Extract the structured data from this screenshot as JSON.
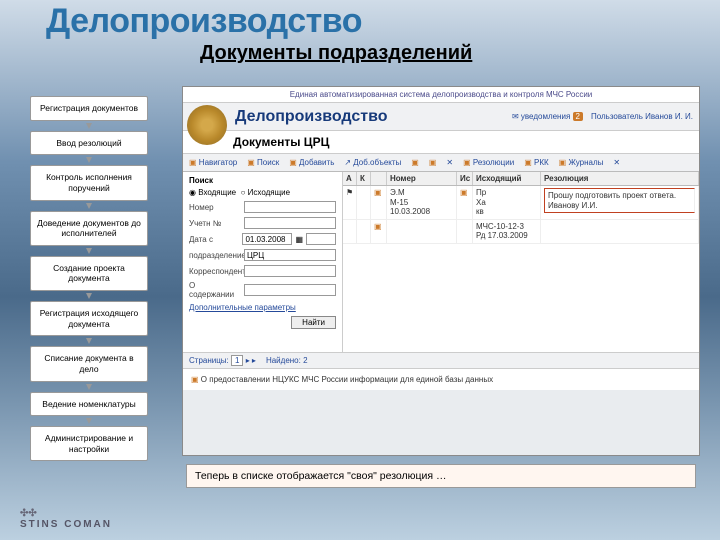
{
  "page": {
    "title": "Делопроизводство",
    "subtitle": "Документы подразделений"
  },
  "sidebar": {
    "items": [
      {
        "label": "Регистрация документов"
      },
      {
        "label": "Ввод резолюций"
      },
      {
        "label": "Контроль исполнения поручений"
      },
      {
        "label": "Доведение документов до исполнителей"
      },
      {
        "label": "Создание проекта документа"
      },
      {
        "label": "Регистрация исходящего документа"
      },
      {
        "label": "Списание документа в дело"
      },
      {
        "label": "Ведение номенклатуры"
      },
      {
        "label": "Администрирование и настройки"
      }
    ]
  },
  "app": {
    "top_banner": "Единая автоматизированная система делопроизводства и контроля МЧС России",
    "title": "Делопроизводство",
    "notify_label": "уведомления",
    "notify_count": "2",
    "user_label": "Пользователь",
    "user_name": "Иванов И. И.",
    "doc_section": "Документы ЦРЦ",
    "tabs": {
      "navigator": "Навигатор",
      "search": "Поиск",
      "add": "Добавить",
      "addmulti": "Доб.объекты",
      "resolutions": "Резолюции",
      "rkk": "РКК",
      "journals": "Журналы"
    },
    "search": {
      "title": "Поиск",
      "mode_in": "Входящие",
      "mode_out": "Исходящие",
      "fields": {
        "number": "Номер",
        "uch": "Учетн №",
        "date": "Дата с",
        "date_val": "01.03.2008",
        "dept": "подразделение",
        "dept_val": "ЦРЦ",
        "corr": "Корреспондент",
        "subject": "О содержании",
        "extra": "Дополнительные параметры"
      },
      "button": "Найти"
    },
    "list": {
      "cols": {
        "a": "А",
        "k": "К",
        "n": "",
        "num": "Номер",
        "i": "Ис",
        "out": "Исходящий",
        "res": "Резолюция"
      },
      "rows": [
        {
          "num_line1": "Э.М",
          "num_line2": "М-15",
          "num_line3": "10.03.2008",
          "out_line1": "Пр",
          "out_line2": "Ха",
          "out_line3": "кв",
          "res": "Прошу подготовить проект ответа. Иванову И.И."
        },
        {
          "num_line1": "",
          "num_line2": "",
          "num_line3": "",
          "out_line1": "МЧС-10-12-3",
          "out_line2": "Рд 17.03.2009",
          "out_line3": "",
          "res": ""
        }
      ],
      "pager_pages": "Страницы:",
      "pager_found": "Найдено: 2"
    },
    "detail": "О предоставлении НЦУКС МЧС России информации для единой базы данных"
  },
  "caption": "Теперь в списке отображается \"своя\" резолюция …",
  "footer": "STINS  COMAN"
}
